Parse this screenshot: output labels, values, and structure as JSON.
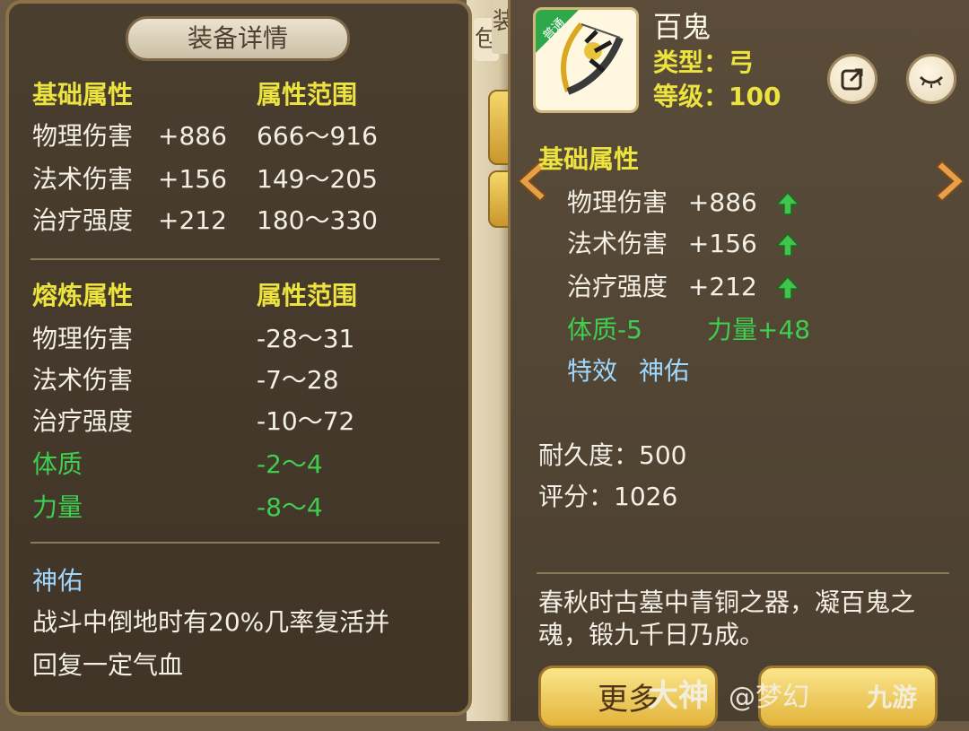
{
  "background": {
    "tab1": "包",
    "tab2": "装"
  },
  "left": {
    "title": "装备详情",
    "base_header": "基础属性",
    "range_header": "属性范围",
    "base_stats": [
      {
        "name": "物理伤害",
        "value": "+886",
        "range": "666～916"
      },
      {
        "name": "法术伤害",
        "value": "+156",
        "range": "149～205"
      },
      {
        "name": "治疗强度",
        "value": "+212",
        "range": "180～330"
      }
    ],
    "refine_header": "熔炼属性",
    "refine_range_header": "属性范围",
    "refine_stats": [
      {
        "name": "物理伤害",
        "range": "-28～31"
      },
      {
        "name": "法术伤害",
        "range": "-7～28"
      },
      {
        "name": "治疗强度",
        "range": "-10～72"
      }
    ],
    "refine_stats_green": [
      {
        "name": "体质",
        "range": "-2～4"
      },
      {
        "name": "力量",
        "range": "-8～4"
      }
    ],
    "effect_name": "神佑",
    "effect_desc_line1": "战斗中倒地时有20%几率复活并",
    "effect_desc_line2": "回复一定气血"
  },
  "right": {
    "item_name": "百鬼",
    "corner_tag": "普通",
    "type_label": "类型：弓",
    "level_label": "等级：100",
    "base_header": "基础属性",
    "stats": [
      {
        "name": "物理伤害",
        "value": "+886"
      },
      {
        "name": "法术伤害",
        "value": "+156"
      },
      {
        "name": "治疗强度",
        "value": "+212"
      }
    ],
    "green_stat1": "体质-5",
    "green_stat2": "力量+48",
    "special_label": "特效",
    "special_value": "神佑",
    "durability": "耐久度：500",
    "score": "评分：1026",
    "description": "春秋时古墓中青铜之器，凝百鬼之魂，锻九千日乃成。",
    "more_button": "更多",
    "icons": [
      "share-icon",
      "eye-icon",
      "arrow-up-icon",
      "chevron-left-icon",
      "chevron-right-icon"
    ]
  },
  "watermark": {
    "text1": "大神",
    "text2": "@梦幻",
    "logo": "九游"
  },
  "colors": {
    "yellow": "#ece33f",
    "green": "#3fcf50",
    "blue": "#9fd8ff",
    "panel": "#4a3e2f"
  }
}
